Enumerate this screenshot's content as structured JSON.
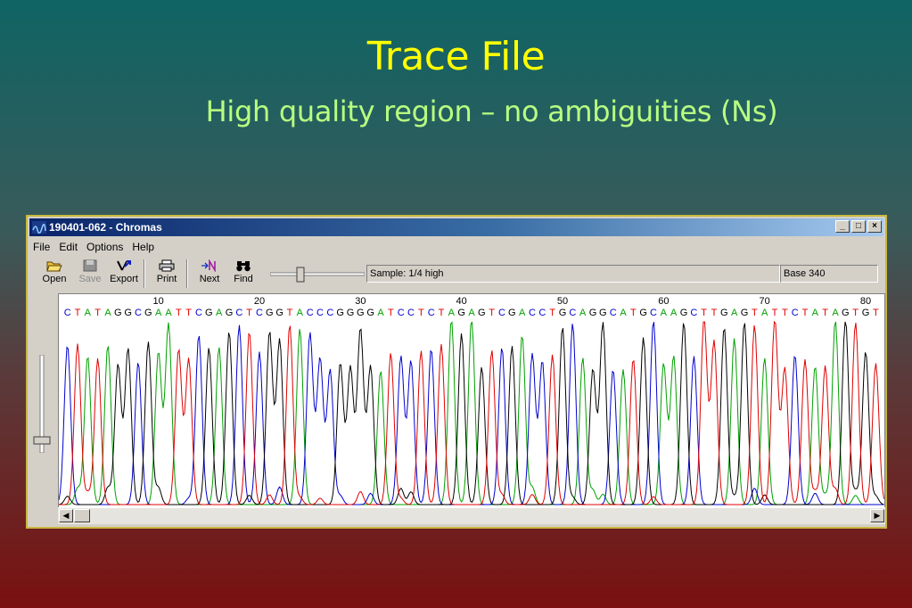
{
  "slide": {
    "title": "Trace File",
    "subtitle": "High quality region – no ambiguities (Ns)"
  },
  "window": {
    "title": "190401-062 - Chromas",
    "controls": [
      "_",
      "□",
      "×"
    ]
  },
  "menu": [
    "File",
    "Edit",
    "Options",
    "Help"
  ],
  "toolbar": {
    "buttons": [
      {
        "label": "Open",
        "icon": "open-folder-icon",
        "enabled": true
      },
      {
        "label": "Save",
        "icon": "save-disk-icon",
        "enabled": false
      },
      {
        "label": "Export",
        "icon": "export-icon",
        "enabled": true
      },
      {
        "label": "Print",
        "icon": "printer-icon",
        "enabled": true
      },
      {
        "label": "Next",
        "icon": "next-n-icon",
        "enabled": true
      },
      {
        "label": "Find",
        "icon": "binoculars-icon",
        "enabled": true
      }
    ],
    "sample_text": "Sample: 1/4 high",
    "base_text": "Base 340"
  },
  "trace": {
    "ticks": [
      "10",
      "20",
      "30",
      "40",
      "50",
      "60",
      "70",
      "80"
    ],
    "sequence": "CTATAGGCGAATTCGAGCTCGGTACCCGGGGATCCTCTAGAGTCGACCTGCAGGCATGCAAGCTTGAGTATTCTATAGTGT",
    "colors": {
      "A": "#00a000",
      "C": "#0000d0",
      "G": "#000000",
      "T": "#e00000"
    }
  }
}
